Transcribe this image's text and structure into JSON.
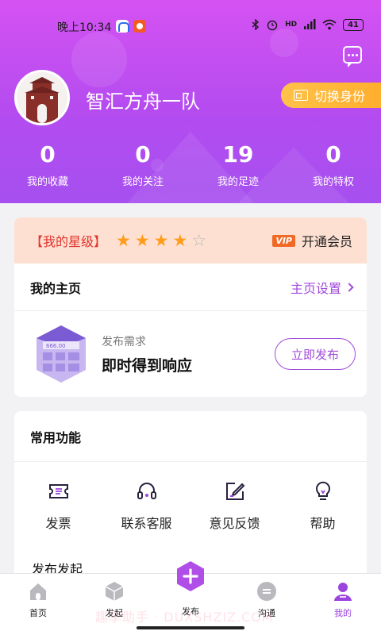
{
  "status": {
    "time": "晚上10:34",
    "network": "HD",
    "battery": "41"
  },
  "header": {
    "team_name": "智汇方舟一队",
    "switch_identity": "切换身份"
  },
  "stats": [
    {
      "value": "0",
      "label": "我的收藏"
    },
    {
      "value": "0",
      "label": "我的关注"
    },
    {
      "value": "19",
      "label": "我的足迹"
    },
    {
      "value": "0",
      "label": "我的特权"
    }
  ],
  "vip": {
    "level_label": "【我的星级】",
    "stars_filled": 4,
    "stars_total": 5,
    "tag": "VIP",
    "open_label": "开通会员"
  },
  "homepage": {
    "title": "我的主页",
    "settings": "主页设置"
  },
  "publish": {
    "card_text": "666.00",
    "subtitle": "发布需求",
    "title": "即时得到响应",
    "button": "立即发布"
  },
  "functions": {
    "title": "常用功能",
    "items": [
      {
        "label": "发票",
        "icon": "ticket-icon"
      },
      {
        "label": "联系客服",
        "icon": "headset-icon"
      },
      {
        "label": "意见反馈",
        "icon": "edit-icon"
      },
      {
        "label": "帮助",
        "icon": "lightbulb-icon"
      }
    ],
    "next_section": "发布发起"
  },
  "tabs": [
    {
      "label": "首页",
      "icon": "home-icon"
    },
    {
      "label": "发起",
      "icon": "cube-icon"
    },
    {
      "label": "发布",
      "icon": "plus-icon"
    },
    {
      "label": "沟通",
      "icon": "chat-icon"
    },
    {
      "label": "我的",
      "icon": "user-icon",
      "active": true
    }
  ],
  "watermark": "趣享助手 · DUXSHZIZ.COM",
  "colors": {
    "header_top": "#d552f2",
    "header_bottom": "#a650ef",
    "accent": "#a04bd9",
    "switch_button": "#ffae2d",
    "star": "#ff9c1a",
    "level_text": "#e2332d",
    "vip_bar_bg": "#fde0d2"
  }
}
